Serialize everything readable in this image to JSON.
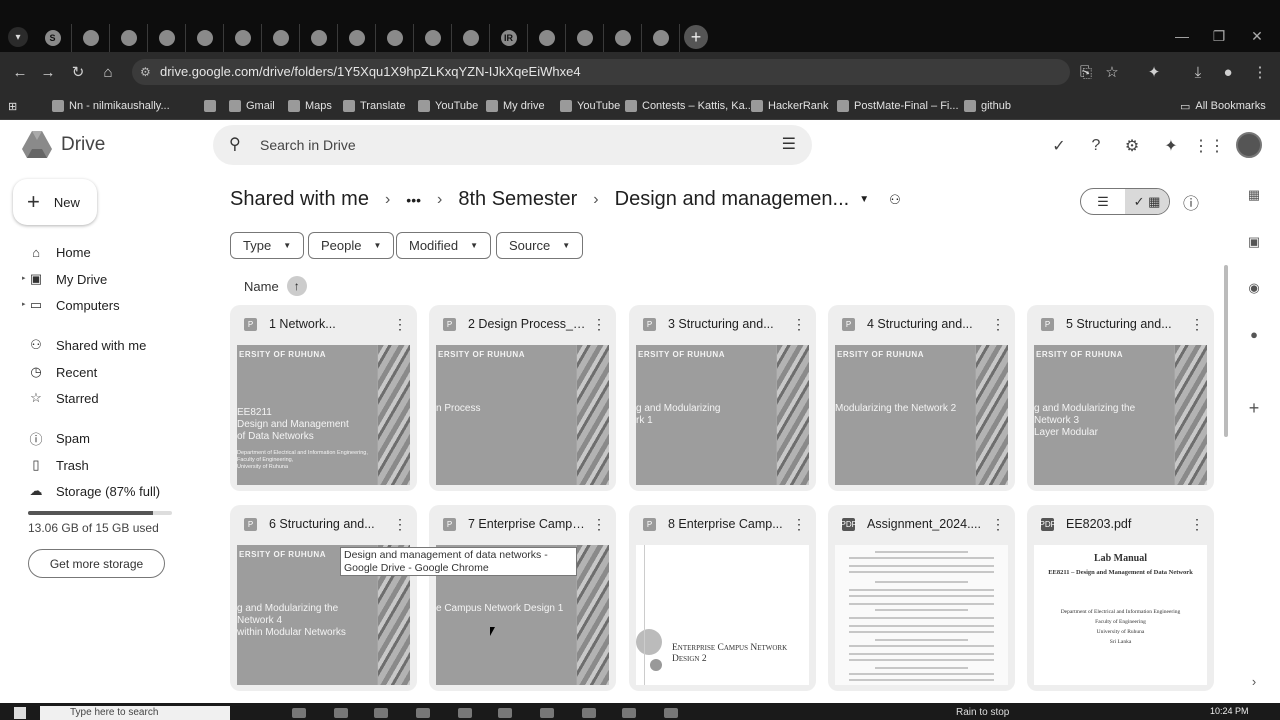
{
  "browser": {
    "tab_icons": [
      "s-icon",
      "drive-icon",
      "chrome-icon",
      "upload-icon",
      "drive-icon",
      "drive-icon",
      "grid-icon",
      "github-icon",
      "doc-icon",
      "openai-icon",
      "loop-icon",
      "sheet-icon",
      "ir-icon",
      "edge-icon",
      "loop-icon",
      "sheet-icon",
      "drive-icon"
    ],
    "tab_letters": [
      "S",
      "",
      "",
      "",
      "",
      "",
      "",
      "",
      "",
      "",
      "",
      "",
      "IR",
      "",
      "",
      "",
      ""
    ],
    "url": "drive.google.com/drive/folders/1Y5Xqu1X9hpZLKxqYZN-IJkXqeEiWhxe4",
    "bookmarks": [
      {
        "label": "Nn - nilmikaushally...",
        "icon": "youtube-icon"
      },
      {
        "label": "",
        "icon": "globe-icon"
      },
      {
        "label": "Gmail",
        "icon": "gmail-icon"
      },
      {
        "label": "Maps",
        "icon": "maps-icon"
      },
      {
        "label": "Translate",
        "icon": "translate-icon"
      },
      {
        "label": "YouTube",
        "icon": "youtube-icon"
      },
      {
        "label": "My drive",
        "icon": "drive-icon"
      },
      {
        "label": "YouTube",
        "icon": "youtube-icon"
      },
      {
        "label": "Contests – Kattis, Ka...",
        "icon": "kattis-icon"
      },
      {
        "label": "HackerRank",
        "icon": "hackerrank-icon"
      },
      {
        "label": "PostMate-Final – Fi...",
        "icon": "figma-icon"
      },
      {
        "label": "github",
        "icon": "github-icon"
      }
    ],
    "all_bookmarks": "All Bookmarks"
  },
  "app": {
    "name": "Drive",
    "search_placeholder": "Search in Drive",
    "new_label": "New"
  },
  "sidebar": {
    "items": [
      {
        "label": "Home",
        "icon": "home-icon"
      },
      {
        "label": "My Drive",
        "icon": "my-drive-icon"
      },
      {
        "label": "Computers",
        "icon": "computer-icon"
      },
      {
        "label": "Shared with me",
        "icon": "people-icon"
      },
      {
        "label": "Recent",
        "icon": "clock-icon"
      },
      {
        "label": "Starred",
        "icon": "star-icon"
      },
      {
        "label": "Spam",
        "icon": "spam-icon"
      },
      {
        "label": "Trash",
        "icon": "trash-icon"
      },
      {
        "label": "Storage (87% full)",
        "icon": "cloud-icon"
      }
    ],
    "storage_used": "13.06 GB of 15 GB used",
    "storage_fraction": 0.87,
    "get_storage": "Get more storage"
  },
  "breadcrumb": {
    "root": "Shared with me",
    "ellipsis": "•••",
    "parent": "8th Semester",
    "current": "Design and managemen..."
  },
  "filters": [
    "Type",
    "People",
    "Modified",
    "Source"
  ],
  "sort": {
    "label": "Name"
  },
  "files": [
    {
      "name": "1 Network...",
      "kind": "slides",
      "slide_title": "EE8211\nDesign and Management\nof Data Networks",
      "slide_sub": "Department of Electrical and Information Engineering,\nFaculty of Engineering,\nUniversity of Ruhuna"
    },
    {
      "name": "2 Design Process_1...",
      "kind": "slides",
      "slide_title": "n Process",
      "slide_sub": ""
    },
    {
      "name": "3 Structuring and...",
      "kind": "slides",
      "slide_title": "g and Modularizing\nrk 1",
      "slide_sub": ""
    },
    {
      "name": "4 Structuring and...",
      "kind": "slides",
      "slide_title": "Modularizing the Network 2",
      "slide_sub": ""
    },
    {
      "name": "5 Structuring and...",
      "kind": "slides",
      "slide_title": "g and Modularizing the Network 3\nLayer Modular",
      "slide_sub": ""
    },
    {
      "name": "6 Structuring and...",
      "kind": "slides",
      "slide_title": "g and Modularizing the Network 4\nwithin Modular Networks",
      "slide_sub": ""
    },
    {
      "name": "7 Enterprise Campu...",
      "kind": "slides",
      "slide_title": "e Campus Network Design 1",
      "slide_sub": ""
    },
    {
      "name": "8 Enterprise Camp...",
      "kind": "slides-white",
      "slide_title": "Enterprise Campus Network\nDesign 2",
      "slide_sub": ""
    },
    {
      "name": "Assignment_2024....",
      "kind": "pdf-doc",
      "slide_title": "",
      "slide_sub": ""
    },
    {
      "name": "EE8203.pdf",
      "kind": "pdf-lab",
      "slide_title": "Lab Manual",
      "slide_sub": "EE8211 – Design and Management of Data Network",
      "dept": "Department of Electrical and Information Engineering\nFaculty of Engineering\nUniversity of Ruhuna\nSri Lanka"
    }
  ],
  "slide_header": "ERSITY OF RUHUNA",
  "tooltip": "Design and management of data networks - Google Drive - Google Chrome",
  "taskbar": {
    "search_placeholder": "Type here to search",
    "weather": "Rain to stop",
    "time": "10:24 PM"
  }
}
